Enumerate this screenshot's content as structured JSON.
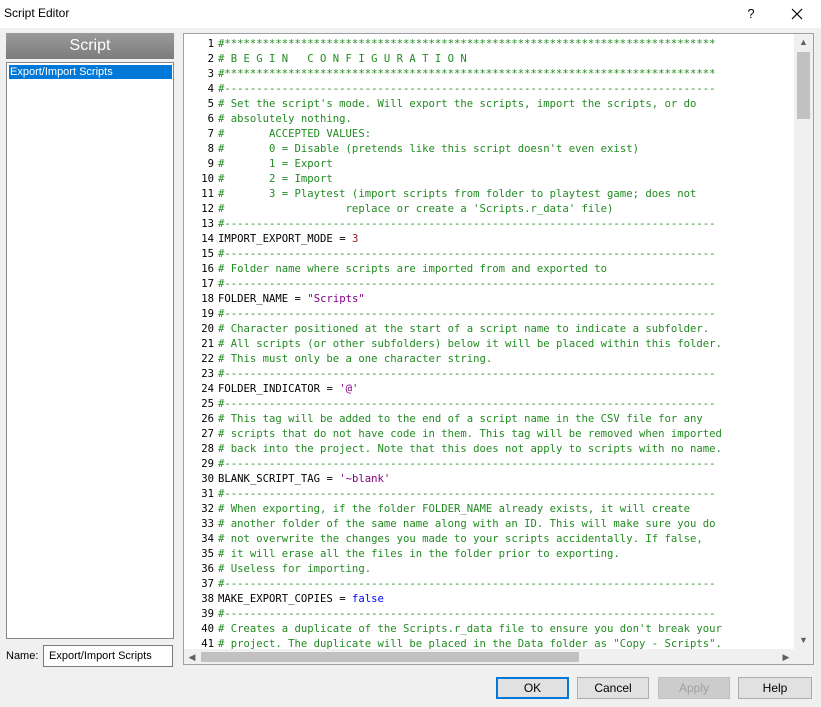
{
  "window": {
    "title": "Script Editor",
    "help_glyph": "?"
  },
  "sidebar": {
    "header": "Script",
    "items": [
      {
        "label": "Export/Import Scripts",
        "selected": true
      }
    ]
  },
  "name_field": {
    "label": "Name:",
    "value": "Export/Import Scripts"
  },
  "editor": {
    "lines": [
      {
        "n": "1",
        "text": "#*****************************************************************************",
        "kind": "comment"
      },
      {
        "n": "2",
        "text": "# B E G I N   C O N F I G U R A T I O N",
        "kind": "comment"
      },
      {
        "n": "3",
        "text": "#*****************************************************************************",
        "kind": "comment"
      },
      {
        "n": "4",
        "text": "#-----------------------------------------------------------------------------",
        "kind": "comment"
      },
      {
        "n": "5",
        "text": "# Set the script's mode. Will export the scripts, import the scripts, or do",
        "kind": "comment"
      },
      {
        "n": "6",
        "text": "# absolutely nothing.",
        "kind": "comment"
      },
      {
        "n": "7",
        "text": "#       ACCEPTED VALUES:",
        "kind": "comment"
      },
      {
        "n": "8",
        "text": "#       0 = Disable (pretends like this script doesn't even exist)",
        "kind": "comment"
      },
      {
        "n": "9",
        "text": "#       1 = Export",
        "kind": "comment"
      },
      {
        "n": "10",
        "text": "#       2 = Import",
        "kind": "comment"
      },
      {
        "n": "11",
        "text": "#       3 = Playtest (import scripts from folder to playtest game; does not",
        "kind": "comment"
      },
      {
        "n": "12",
        "text": "#                   replace or create a 'Scripts.r_data' file)",
        "kind": "comment"
      },
      {
        "n": "13",
        "text": "#-----------------------------------------------------------------------------",
        "kind": "comment"
      },
      {
        "n": "14",
        "kind": "assign",
        "name": "IMPORT_EXPORT_MODE",
        "op": " = ",
        "value": "3",
        "vkind": "num"
      },
      {
        "n": "15",
        "text": "#-----------------------------------------------------------------------------",
        "kind": "comment"
      },
      {
        "n": "16",
        "text": "# Folder name where scripts are imported from and exported to",
        "kind": "comment"
      },
      {
        "n": "17",
        "text": "#-----------------------------------------------------------------------------",
        "kind": "comment"
      },
      {
        "n": "18",
        "kind": "assign",
        "name": "FOLDER_NAME",
        "op": " = ",
        "value": "\"Scripts\"",
        "vkind": "str"
      },
      {
        "n": "19",
        "text": "#-----------------------------------------------------------------------------",
        "kind": "comment"
      },
      {
        "n": "20",
        "text": "# Character positioned at the start of a script name to indicate a subfolder.",
        "kind": "comment"
      },
      {
        "n": "21",
        "text": "# All scripts (or other subfolders) below it will be placed within this folder.",
        "kind": "comment"
      },
      {
        "n": "22",
        "text": "# This must only be a one character string.",
        "kind": "comment"
      },
      {
        "n": "23",
        "text": "#-----------------------------------------------------------------------------",
        "kind": "comment"
      },
      {
        "n": "24",
        "kind": "assign",
        "name": "FOLDER_INDICATOR",
        "op": " = ",
        "value": "'@'",
        "vkind": "str"
      },
      {
        "n": "25",
        "text": "#-----------------------------------------------------------------------------",
        "kind": "comment"
      },
      {
        "n": "26",
        "text": "# This tag will be added to the end of a script name in the CSV file for any",
        "kind": "comment"
      },
      {
        "n": "27",
        "text": "# scripts that do not have code in them. This tag will be removed when imported",
        "kind": "comment"
      },
      {
        "n": "28",
        "text": "# back into the project. Note that this does not apply to scripts with no name.",
        "kind": "comment"
      },
      {
        "n": "29",
        "text": "#-----------------------------------------------------------------------------",
        "kind": "comment"
      },
      {
        "n": "30",
        "kind": "assign",
        "name": "BLANK_SCRIPT_TAG",
        "op": " = ",
        "value": "'~blank'",
        "vkind": "str"
      },
      {
        "n": "31",
        "text": "#-----------------------------------------------------------------------------",
        "kind": "comment"
      },
      {
        "n": "32",
        "text": "# When exporting, if the folder FOLDER_NAME already exists, it will create",
        "kind": "comment"
      },
      {
        "n": "33",
        "text": "# another folder of the same name along with an ID. This will make sure you do",
        "kind": "comment"
      },
      {
        "n": "34",
        "text": "# not overwrite the changes you made to your scripts accidentally. If false,",
        "kind": "comment"
      },
      {
        "n": "35",
        "text": "# it will erase all the files in the folder prior to exporting.",
        "kind": "comment"
      },
      {
        "n": "36",
        "text": "# Useless for importing.",
        "kind": "comment"
      },
      {
        "n": "37",
        "text": "#-----------------------------------------------------------------------------",
        "kind": "comment"
      },
      {
        "n": "38",
        "kind": "assign",
        "name": "MAKE_EXPORT_COPIES",
        "op": " = ",
        "value": "false",
        "vkind": "kw"
      },
      {
        "n": "39",
        "text": "#-----------------------------------------------------------------------------",
        "kind": "comment"
      },
      {
        "n": "40",
        "text": "# Creates a duplicate of the Scripts.r_data file to ensure you don't break your",
        "kind": "comment"
      },
      {
        "n": "41",
        "text": "# project. The duplicate will be placed in the Data folder as \"Copy - Scripts\".",
        "kind": "comment"
      }
    ]
  },
  "buttons": {
    "ok": "OK",
    "cancel": "Cancel",
    "apply": "Apply",
    "help": "Help"
  },
  "colors": {
    "comment": "#228b22",
    "number": "#9b1b1b",
    "string": "#800080",
    "keyword": "#0000ff",
    "selection": "#0078d7"
  }
}
